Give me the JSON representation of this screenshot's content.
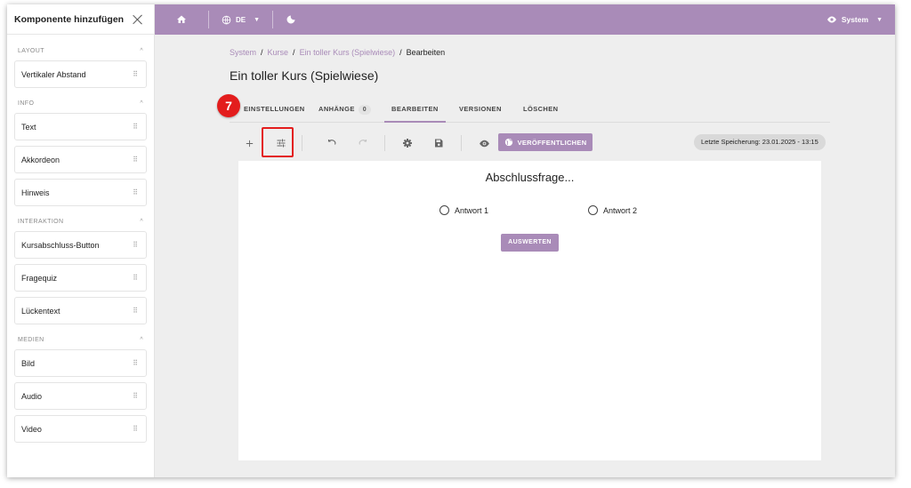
{
  "sidebar": {
    "title": "Komponente hinzufügen",
    "sections": [
      {
        "label": "LAYOUT",
        "items": [
          "Vertikaler Abstand"
        ]
      },
      {
        "label": "INFO",
        "items": [
          "Text",
          "Akkordeon",
          "Hinweis"
        ]
      },
      {
        "label": "INTERAKTION",
        "items": [
          "Kursabschluss-Button",
          "Fragequiz",
          "Lückentext"
        ]
      },
      {
        "label": "MEDIEN",
        "items": [
          "Bild",
          "Audio",
          "Video"
        ]
      }
    ],
    "drag_glyph": "⠿",
    "collapse_glyph": "^"
  },
  "topbar": {
    "language": "DE",
    "user_label": "System",
    "color": "#a98bb8"
  },
  "breadcrumb": {
    "items": [
      "System",
      "Kurse",
      "Ein toller Kurs (Spielwiese)",
      "Bearbeiten"
    ],
    "separator": "/"
  },
  "page": {
    "title": "Ein toller Kurs (Spielwiese)"
  },
  "tabs": {
    "items": [
      {
        "label": "EINSTELLUNGEN"
      },
      {
        "label": "ANHÄNGE",
        "badge": "0"
      },
      {
        "label": "BEARBEITEN",
        "active": true
      },
      {
        "label": "VERSIONEN"
      },
      {
        "label": "LÖSCHEN"
      }
    ]
  },
  "annotation": {
    "step_number": "7",
    "color": "#e31d1d"
  },
  "toolbar": {
    "publish_label": "VERÖFFENTLICHEN",
    "last_saved": "Letzte Speicherung: 23.01.2025 - 13:15",
    "icons": [
      "add-icon",
      "tune-icon",
      "undo-icon",
      "redo-icon",
      "settings-icon",
      "save-icon",
      "preview-eye-icon",
      "globe-icon"
    ]
  },
  "quiz": {
    "question": "Abschlussfrage...",
    "answers": [
      "Antwort 1",
      "Antwort 2"
    ],
    "submit_label": "AUSWERTEN"
  }
}
